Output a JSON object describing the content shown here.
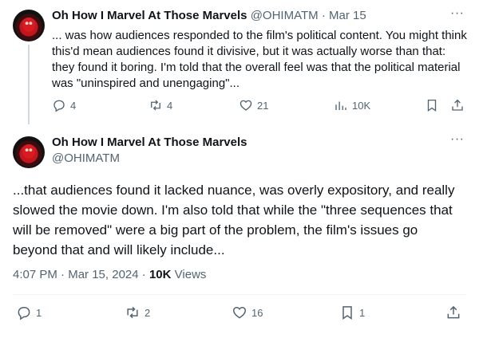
{
  "tweet1": {
    "name": "Oh How I Marvel At Those Marvels",
    "handle": "@OHIMATM",
    "separator": "·",
    "date": "Mar 15",
    "more": "···",
    "text": "... was how audiences responded to the film's political content. You might think this'd mean audiences found it divisive, but it was actually worse than that: they found it boring. I'm told that the overall feel was that the political material was \"uninspired and unengaging\"...",
    "actions": {
      "replies": "4",
      "reposts": "4",
      "likes": "21",
      "views": "10K"
    }
  },
  "tweet2": {
    "name": "Oh How I Marvel At Those Marvels",
    "handle": "@OHIMATM",
    "more": "···",
    "text": "...that audiences found it lacked nuance, was overly expository, and really slowed the movie down. I'm also told that while the \"three sequences that will be removed\" were a big part of the problem, the film's issues go beyond that and will likely include...",
    "time": "4:07 PM",
    "date": "Mar 15, 2024",
    "views_count": "10K",
    "views_label": "Views",
    "actions": {
      "replies": "1",
      "reposts": "2",
      "likes": "16",
      "bookmarks": "1"
    }
  },
  "icons": {
    "reply": "reply-icon",
    "repost": "repost-icon",
    "like": "heart-icon",
    "views": "analytics-icon",
    "bookmark": "bookmark-icon",
    "share": "share-icon",
    "more": "more-icon"
  },
  "colors": {
    "text": "#0f1419",
    "secondary": "#536471",
    "thread_line": "#cfd9de",
    "divider": "#eff3f4"
  }
}
